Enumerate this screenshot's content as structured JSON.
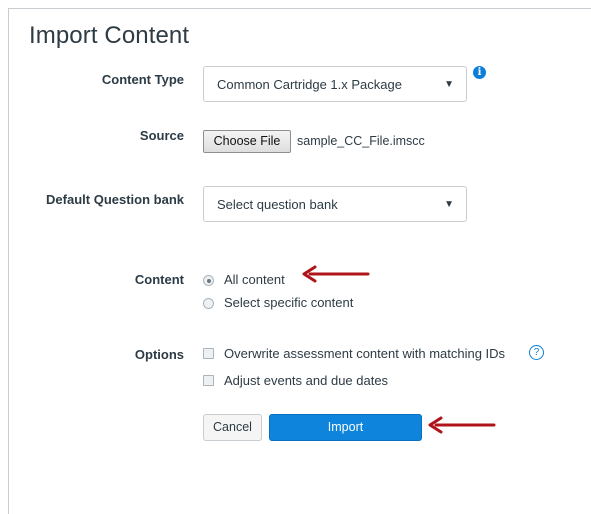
{
  "page": {
    "title": "Import Content"
  },
  "form": {
    "content_type": {
      "label": "Content Type",
      "selected": "Common Cartridge 1.x Package",
      "info_icon": "i"
    },
    "source": {
      "label": "Source",
      "button_label": "Choose File",
      "file_name": "sample_CC_File.imscc"
    },
    "question_bank": {
      "label": "Default Question bank",
      "selected": "Select question bank"
    },
    "content": {
      "label": "Content",
      "options": [
        {
          "label": "All content",
          "checked": true
        },
        {
          "label": "Select specific content",
          "checked": false
        }
      ]
    },
    "options": {
      "label": "Options",
      "items": [
        {
          "label": "Overwrite assessment content with matching IDs",
          "checked": false
        },
        {
          "label": "Adjust events and due dates",
          "checked": false
        }
      ],
      "help_icon": "?"
    },
    "buttons": {
      "cancel": "Cancel",
      "import": "Import"
    }
  },
  "colors": {
    "accent": "#0e84dc",
    "annotation_arrow": "#b0141b",
    "text": "#2d3b45"
  }
}
